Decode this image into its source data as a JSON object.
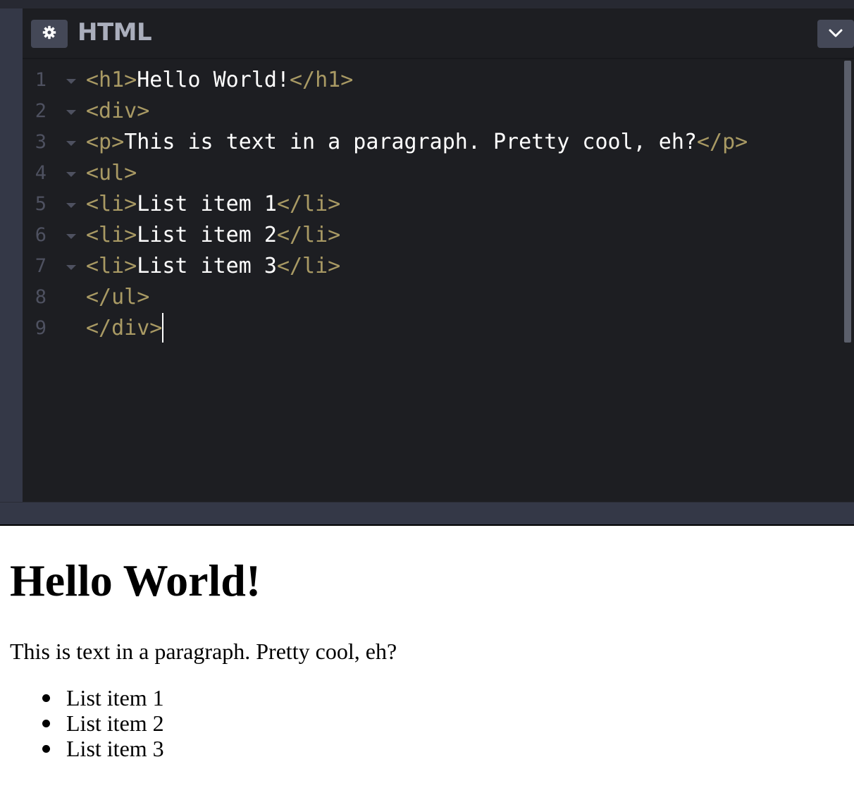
{
  "panel": {
    "title": "HTML",
    "settings_icon": "gear-icon",
    "collapse_icon": "chevron-down-icon"
  },
  "editor": {
    "line_numbers": [
      "1",
      "2",
      "3",
      "4",
      "5",
      "6",
      "7",
      "8",
      "9"
    ],
    "lines": [
      {
        "open": "<h1>",
        "text": "Hello World!",
        "close": "</h1>"
      },
      {
        "open": "<div>",
        "text": "",
        "close": ""
      },
      {
        "open": "<p>",
        "text": "This is text in a paragraph. Pretty cool, eh?",
        "close": "</p>"
      },
      {
        "open": "<ul>",
        "text": "",
        "close": ""
      },
      {
        "open": "<li>",
        "text": "List item 1",
        "close": "</li>"
      },
      {
        "open": "<li>",
        "text": "List item 2",
        "close": "</li>"
      },
      {
        "open": "<li>",
        "text": "List item 3",
        "close": "</li>"
      },
      {
        "open": "</ul>",
        "text": "",
        "close": ""
      },
      {
        "open": "</div>",
        "text": "",
        "close": ""
      }
    ],
    "colors": {
      "tag": "#a99a64",
      "text": "#ffffff",
      "background": "#1d1e22"
    }
  },
  "preview": {
    "heading": "Hello World!",
    "paragraph": "This is text in a paragraph. Pretty cool, eh?",
    "list_items": [
      "List item 1",
      "List item 2",
      "List item 3"
    ]
  }
}
